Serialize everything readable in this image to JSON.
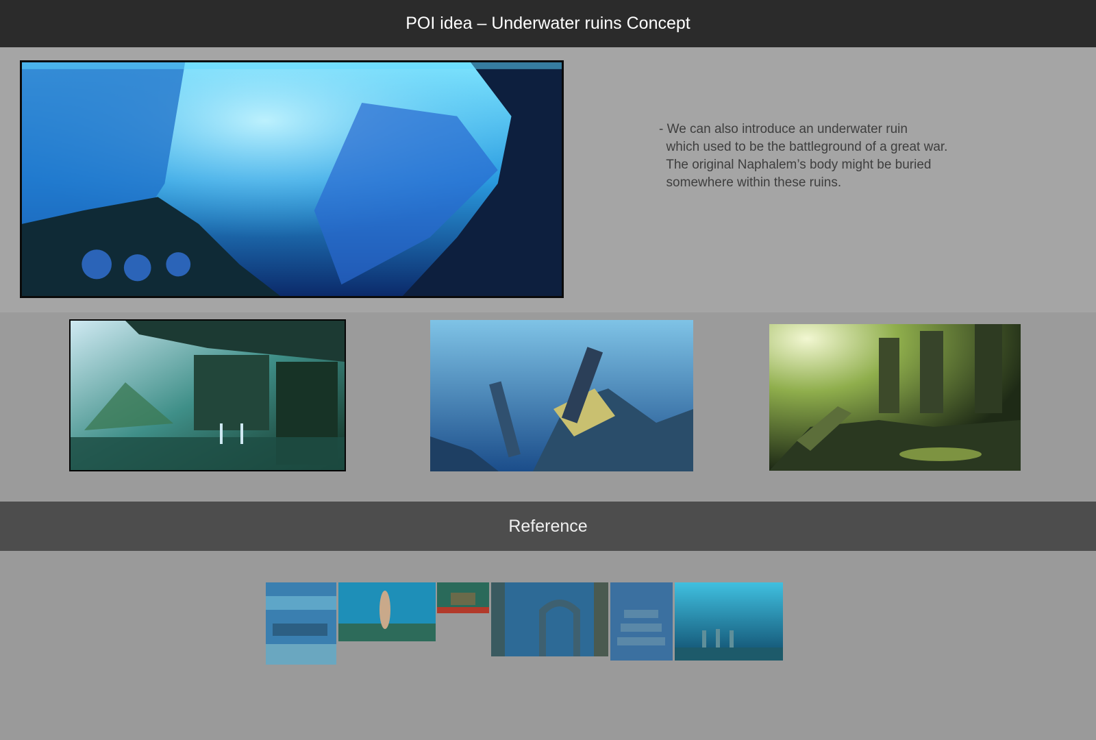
{
  "header": {
    "title": "POI idea – Underwater ruins Concept"
  },
  "description": {
    "lines": [
      "- We can also introduce an underwater ruin",
      "  which used to be the battleground of a great war.",
      "  The original Naphalem’s body might be buried",
      "  somewhere within these ruins."
    ]
  },
  "reference": {
    "label": "Reference"
  },
  "colors": {
    "header_bg": "#2b2b2b",
    "reference_bar_bg": "#4d4d4d",
    "page_bg": "#999999",
    "text": "#3e3e3e"
  }
}
